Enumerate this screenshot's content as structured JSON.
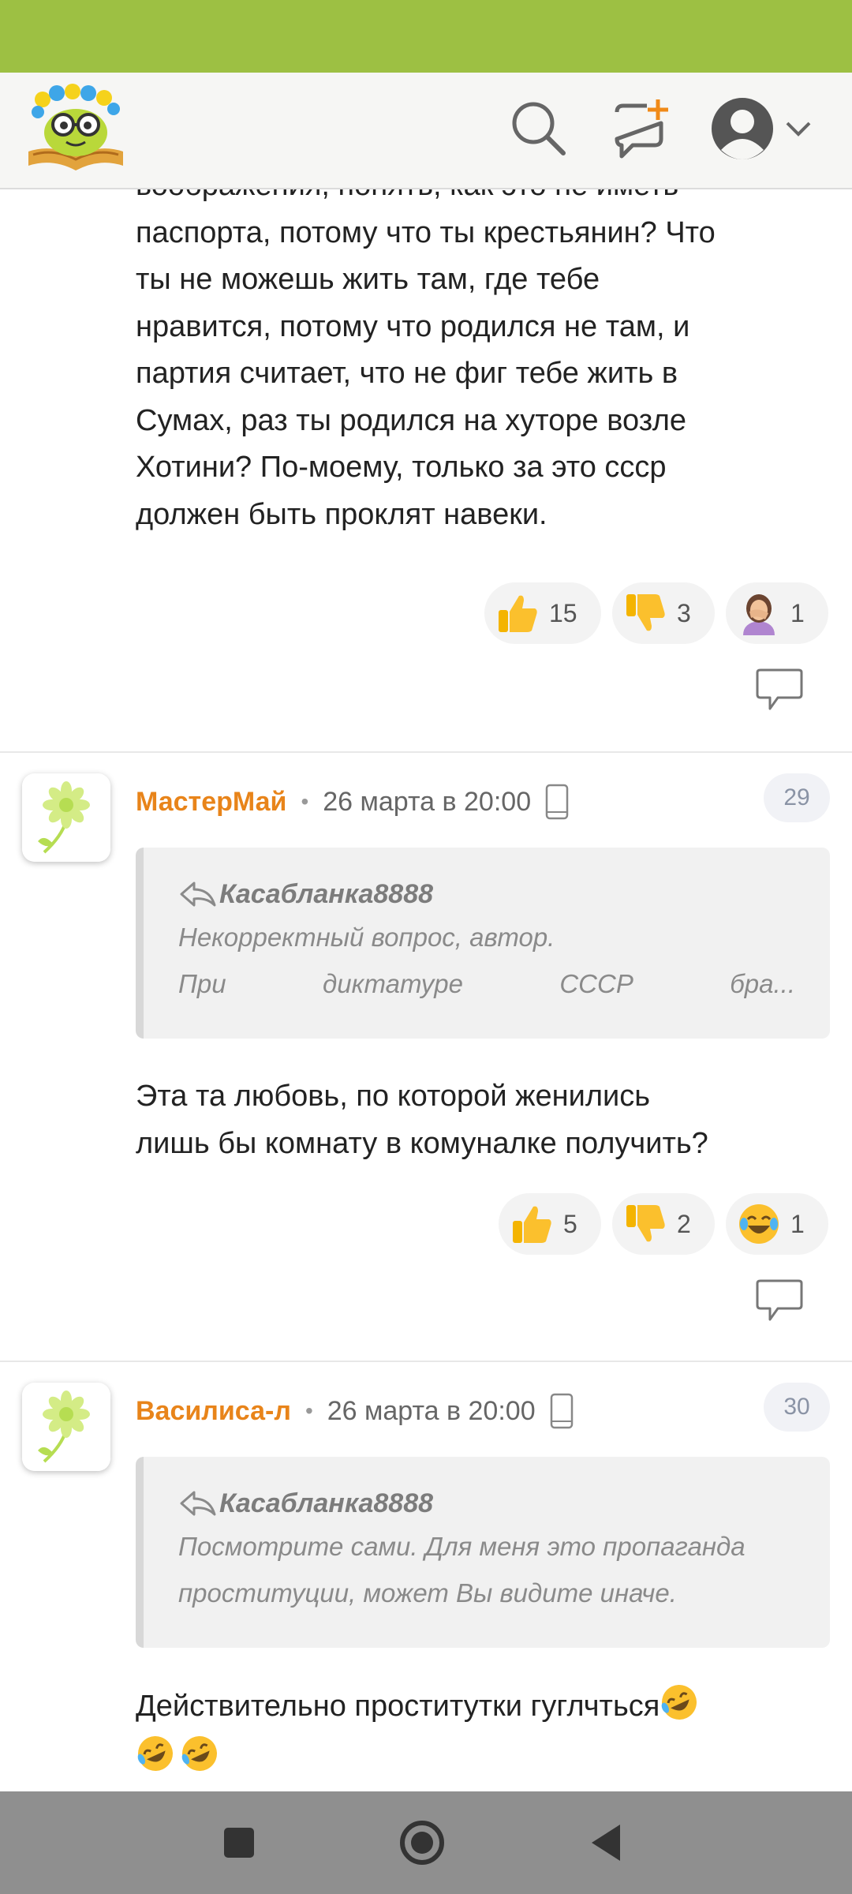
{
  "comment_top": {
    "lines": [
      "воображения, понять, как это не иметь",
      "паспорта, потому что ты крестьянин? Что",
      "ты не можешь жить там, где тебе",
      "нравится, потому что родился не там, и",
      "партия считает, что не фиг тебе жить в",
      "Сумах, раз ты родился на хуторе возле",
      "Хотини? По-моему, только за это ссср",
      "должен быть проклят навеки."
    ],
    "reactions": [
      {
        "icon": "thumbs-up-icon",
        "count": "15"
      },
      {
        "icon": "thumbs-down-icon",
        "count": "3"
      },
      {
        "icon": "facepalm-icon",
        "count": "1"
      }
    ]
  },
  "comment_29": {
    "author": "МастерМай",
    "date": "26 марта в 20:00",
    "number": "29",
    "quote_author": "Касабланка8888",
    "quote_line1": "Некорректный вопрос, автор.",
    "quote_words": [
      "При",
      "диктатуре",
      "СССР",
      "бра..."
    ],
    "lines": [
      "Эта та любовь, по которой женились",
      "лишь бы комнату в комуналке получить?"
    ],
    "reactions": [
      {
        "icon": "thumbs-up-icon",
        "count": "5"
      },
      {
        "icon": "thumbs-down-icon",
        "count": "2"
      },
      {
        "icon": "laughing-icon",
        "count": "1"
      }
    ]
  },
  "comment_30": {
    "author": "Василиса-л",
    "date": "26 марта в 20:00",
    "number": "30",
    "quote_author": "Касабланка8888",
    "quote_lines": [
      "Посмотрите сами. Для меня это пропаганда",
      "проституции, может Вы видите иначе."
    ],
    "line1": "Действительно проститутки гуглчться"
  },
  "colors": {
    "status_bar": "#9dc043",
    "author": "#e8841a",
    "nav_bar": "#8f8f8f"
  }
}
